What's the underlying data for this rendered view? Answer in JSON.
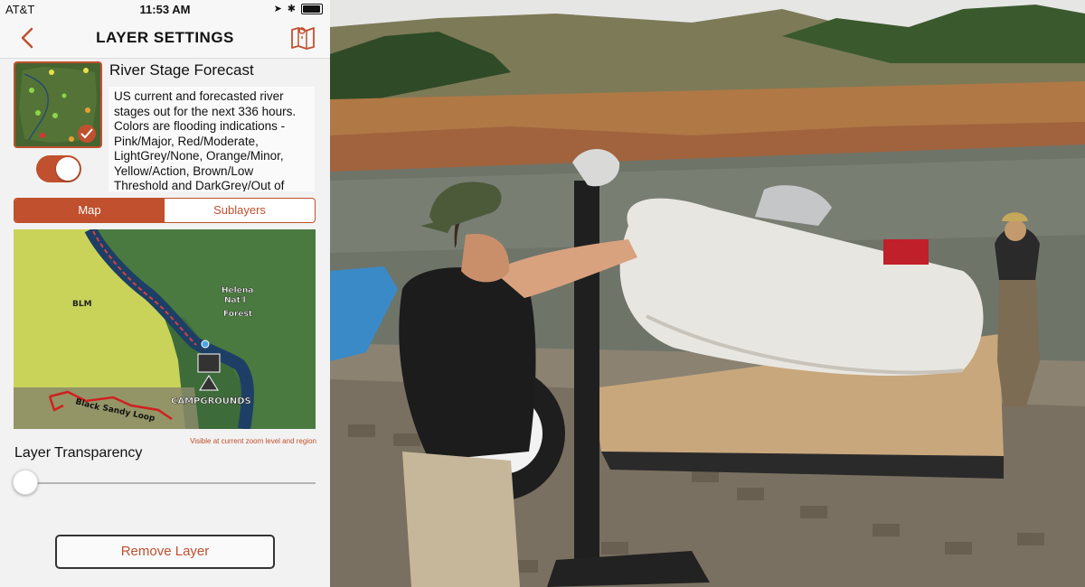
{
  "status_bar": {
    "carrier": "AT&T",
    "time": "11:53 AM"
  },
  "nav": {
    "title": "LAYER SETTINGS",
    "back_icon": "chevron-left-icon",
    "map_icon": "folded-map-icon"
  },
  "layer": {
    "name": "River Stage Forecast",
    "description": "US  current and forecasted river stages out for the next 336 hours. Colors are flooding indications - Pink/Major, Red/Moderate, LightGrey/None, Orange/Minor, Yellow/Action, Brown/Low Threshold and DarkGrey/Out of",
    "enabled": true
  },
  "tabs": [
    {
      "label": "Map",
      "active": true
    },
    {
      "label": "Sublayers",
      "active": false
    }
  ],
  "map_preview": {
    "labels": {
      "blm": "BLM",
      "forest_line1": "Helena",
      "forest_line2": "Nat'l",
      "forest_line3": "Forest",
      "trail_line1": "Black",
      "trail_line2": "Sandy Loop",
      "campgrounds": "CAMPGROUNDS"
    },
    "caption": "Visible at current zoom level and region"
  },
  "transparency": {
    "label": "Layer Transparency",
    "value": 0
  },
  "remove_button": "Remove Layer",
  "colors": {
    "accent": "#c0502e",
    "background": "#f2f2f2"
  }
}
